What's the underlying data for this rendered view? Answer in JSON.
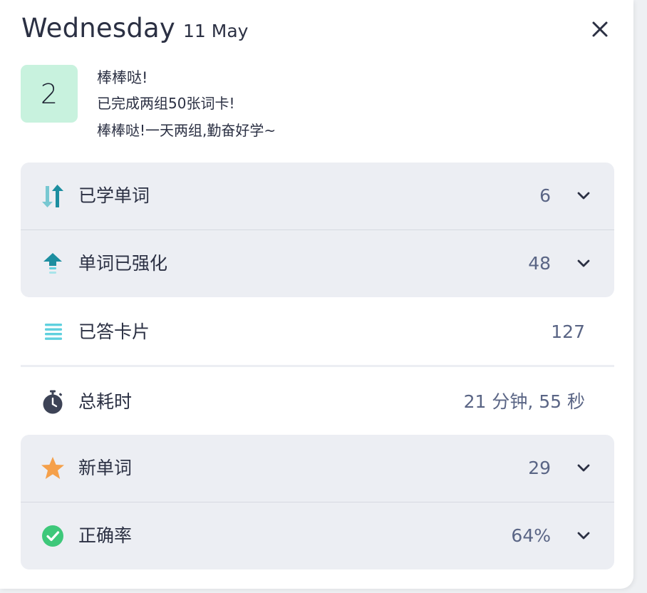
{
  "header": {
    "day": "Wednesday",
    "date": "11 May"
  },
  "badge": {
    "number": "2",
    "color": "#c8f2de"
  },
  "message": {
    "title": "棒棒哒!",
    "line1": "已完成两组50张词卡!",
    "line2": "棒棒哒!一天两组,勤奋好学~"
  },
  "stats": {
    "learned_words": {
      "label": "已学单词",
      "value": "6",
      "icon": "swap-arrows-icon"
    },
    "strengthened": {
      "label": "单词已强化",
      "value": "48",
      "icon": "upload-arrow-icon"
    },
    "answered_cards": {
      "label": "已答卡片",
      "value": "127",
      "icon": "list-lines-icon"
    },
    "total_time": {
      "label": "总耗时",
      "value": "21 分钟, 55 秒",
      "icon": "stopwatch-icon"
    },
    "new_words": {
      "label": "新单词",
      "value": "29",
      "icon": "star-icon"
    },
    "accuracy": {
      "label": "正确率",
      "value": "64%",
      "icon": "check-circle-icon"
    }
  },
  "colors": {
    "teal": "#1c8ea0",
    "teal_light": "#78c8d2",
    "accent_cyan": "#5fd0de",
    "star": "#f5a04a",
    "check": "#3ec87a",
    "dark": "#3d4356"
  }
}
